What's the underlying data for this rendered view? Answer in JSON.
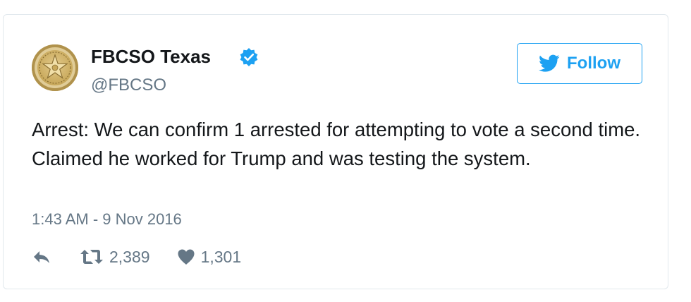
{
  "tweet": {
    "author": {
      "name": "FBCSO Texas",
      "handle": "@FBCSO",
      "verified": true,
      "avatar_icon": "sheriff-star-badge-icon"
    },
    "follow_button": {
      "label": "Follow",
      "icon": "twitter-bird-icon"
    },
    "text": "Arrest: We can confirm 1 arrested for attempting to vote a second time. Claimed he worked for Trump and was testing the system.",
    "timestamp": "1:43 AM - 9 Nov 2016",
    "actions": {
      "reply_icon": "reply-arrow-icon",
      "retweet_icon": "retweet-icon",
      "retweet_count": "2,389",
      "like_icon": "heart-icon",
      "like_count": "1,301"
    }
  },
  "colors": {
    "accent": "#1da1f2",
    "text": "#14171a",
    "muted": "#657786",
    "border": "#e1e8ed"
  }
}
